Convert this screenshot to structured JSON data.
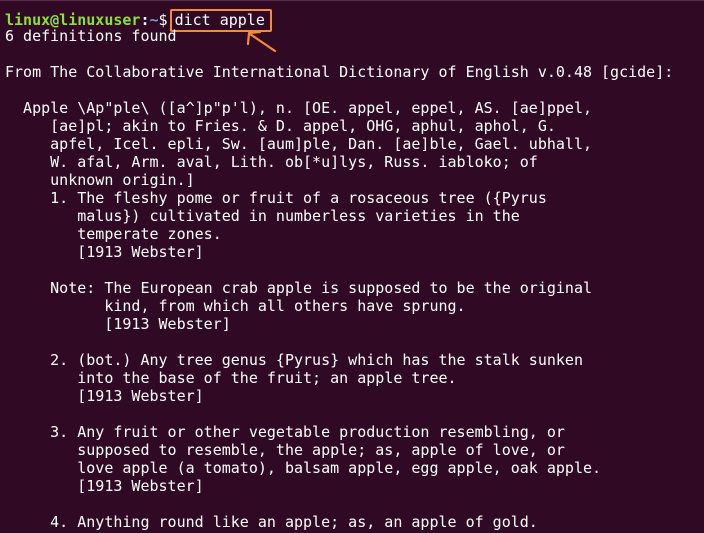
{
  "prompt": {
    "user_host": "linux@linuxuser",
    "separator": ":",
    "path": "~",
    "symbol": "$",
    "command": "dict apple"
  },
  "highlight_color": "#f58a3c",
  "output": [
    "6 definitions found",
    "",
    "From The Collaborative International Dictionary of English v.0.48 [gcide]:",
    "",
    "  Apple \\Ap\"ple\\ ([a^]p\"p'l), n. [OE. appel, eppel, AS. [ae]ppel,",
    "     [ae]pl; akin to Fries. & D. appel, OHG, aphul, aphol, G.",
    "     apfel, Icel. epli, Sw. [aum]ple, Dan. [ae]ble, Gael. ubhall,",
    "     W. afal, Arm. aval, Lith. ob[*u]lys, Russ. iabloko; of",
    "     unknown origin.]",
    "     1. The fleshy pome or fruit of a rosaceous tree ({Pyrus",
    "        malus}) cultivated in numberless varieties in the",
    "        temperate zones.",
    "        [1913 Webster]",
    "",
    "     Note: The European crab apple is supposed to be the original",
    "           kind, from which all others have sprung.",
    "           [1913 Webster]",
    "",
    "     2. (bot.) Any tree genus {Pyrus} which has the stalk sunken",
    "        into the base of the fruit; an apple tree.",
    "        [1913 Webster]",
    "",
    "     3. Any fruit or other vegetable production resembling, or",
    "        supposed to resemble, the apple; as, apple of love, or",
    "        love apple (a tomato), balsam apple, egg apple, oak apple.",
    "        [1913 Webster]",
    "",
    "     4. Anything round like an apple; as, an apple of gold."
  ]
}
